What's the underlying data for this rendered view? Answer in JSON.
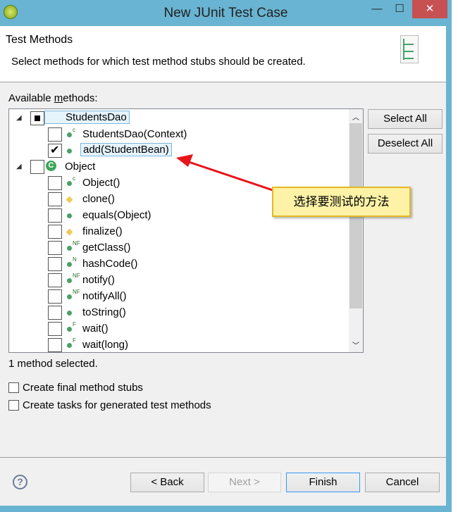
{
  "window": {
    "title": "New JUnit Test Case",
    "close": "✕",
    "minimize": "—",
    "maximize": "☐"
  },
  "header": {
    "title": "Test Methods",
    "description": "Select methods for which test method stubs should be created."
  },
  "available_label_pre": "Available ",
  "available_label_u": "m",
  "available_label_post": "ethods:",
  "tree": [
    {
      "label": "StudentsDao",
      "level": 0,
      "kind": "class",
      "state": "partial",
      "selected": true
    },
    {
      "label": "StudentsDao(Context)",
      "level": 1,
      "kind": "public",
      "mod": "c",
      "state": "unchecked"
    },
    {
      "label": "add(StudentBean)",
      "level": 1,
      "kind": "public",
      "mod": "",
      "state": "checked",
      "selected": true
    },
    {
      "label": "Object",
      "level": 0,
      "kind": "class",
      "state": "unchecked"
    },
    {
      "label": "Object()",
      "level": 1,
      "kind": "public",
      "mod": "c",
      "state": "unchecked"
    },
    {
      "label": "clone()",
      "level": 1,
      "kind": "protected",
      "mod": "",
      "state": "unchecked"
    },
    {
      "label": "equals(Object)",
      "level": 1,
      "kind": "public",
      "mod": "",
      "state": "unchecked"
    },
    {
      "label": "finalize()",
      "level": 1,
      "kind": "protected",
      "mod": "",
      "state": "unchecked"
    },
    {
      "label": "getClass()",
      "level": 1,
      "kind": "public",
      "mod": "NF",
      "state": "unchecked"
    },
    {
      "label": "hashCode()",
      "level": 1,
      "kind": "public",
      "mod": "N",
      "state": "unchecked"
    },
    {
      "label": "notify()",
      "level": 1,
      "kind": "public",
      "mod": "NF",
      "state": "unchecked"
    },
    {
      "label": "notifyAll()",
      "level": 1,
      "kind": "public",
      "mod": "NF",
      "state": "unchecked"
    },
    {
      "label": "toString()",
      "level": 1,
      "kind": "public",
      "mod": "",
      "state": "unchecked"
    },
    {
      "label": "wait()",
      "level": 1,
      "kind": "public",
      "mod": "F",
      "state": "unchecked"
    },
    {
      "label": "wait(long)",
      "level": 1,
      "kind": "public",
      "mod": "F",
      "state": "unchecked"
    }
  ],
  "buttons": {
    "select_all": "Select All",
    "deselect_all": "Deselect All",
    "back": "< Back",
    "next": "Next >",
    "finish": "Finish",
    "cancel": "Cancel"
  },
  "status": "1 method selected.",
  "options": [
    {
      "label": "Create final method stubs",
      "checked": false
    },
    {
      "label": "Create tasks for generated test methods",
      "checked": false
    }
  ],
  "annotation": {
    "text": "选择要测试的方法",
    "color": "#e8141b"
  },
  "colors": {
    "frame": "#69b4d2",
    "close": "#c75050",
    "selection": "#e5f3fb"
  }
}
